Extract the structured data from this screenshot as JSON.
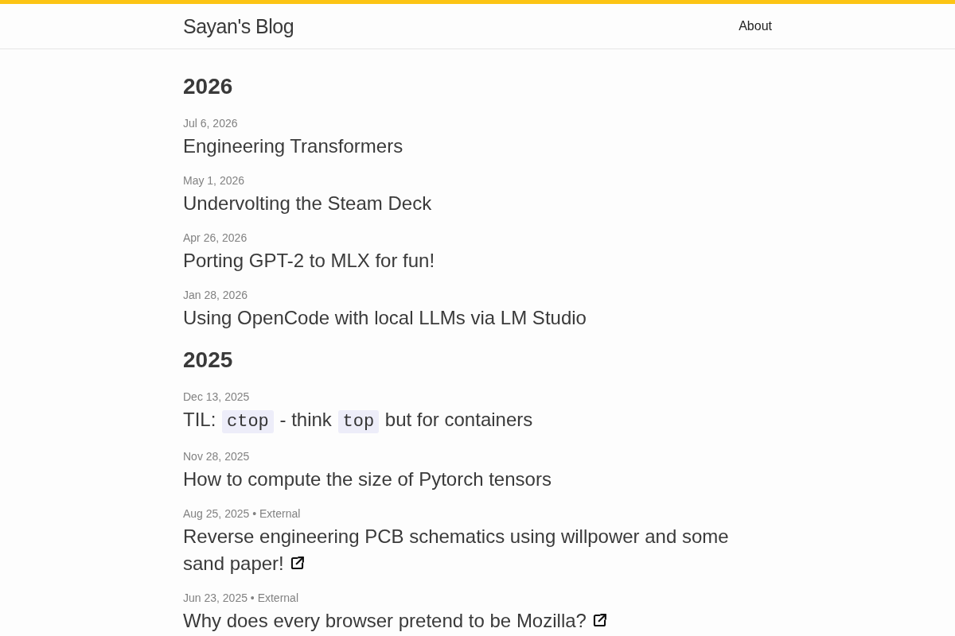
{
  "header": {
    "site_title": "Sayan's Blog",
    "nav": [
      {
        "label": "About"
      }
    ]
  },
  "years": [
    {
      "year": "2026",
      "posts": [
        {
          "meta": "Jul 6, 2026",
          "title": "Engineering Transformers",
          "external": false
        },
        {
          "meta": "May 1, 2026",
          "title": "Undervolting the Steam Deck",
          "external": false
        },
        {
          "meta": "Apr 26, 2026",
          "title": "Porting GPT-2 to MLX for fun!",
          "external": false
        },
        {
          "meta": "Jan 28, 2026",
          "title": "Using OpenCode with local LLMs via LM Studio",
          "external": false
        }
      ]
    },
    {
      "year": "2025",
      "posts": [
        {
          "meta": "Dec 13, 2025",
          "title_parts": [
            {
              "kind": "text",
              "text": "TIL: "
            },
            {
              "kind": "code",
              "text": "ctop"
            },
            {
              "kind": "text",
              "text": " - think "
            },
            {
              "kind": "code",
              "text": "top"
            },
            {
              "kind": "text",
              "text": " but for containers"
            }
          ],
          "external": false
        },
        {
          "meta": "Nov 28, 2025",
          "title": "How to compute the size of Pytorch tensors",
          "external": false
        },
        {
          "meta": "Aug 25, 2025 • External",
          "title": "Reverse engineering PCB schematics using willpower and some sand paper!",
          "external": true
        },
        {
          "meta": "Jun 23, 2025 • External",
          "title": "Why does every browser pretend to be Mozilla?",
          "external": true
        }
      ]
    }
  ]
}
